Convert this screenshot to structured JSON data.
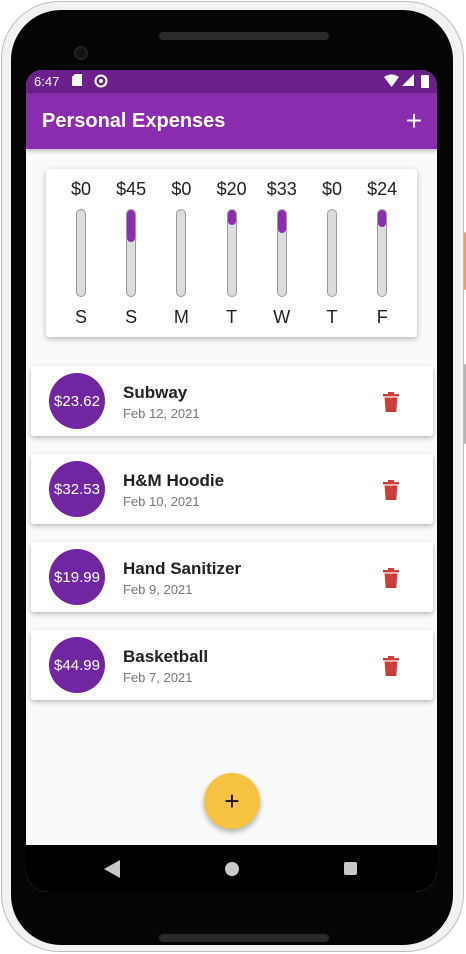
{
  "status_bar": {
    "time": "6:47",
    "icons": [
      "sd-card-icon",
      "sync-icon",
      "wifi-icon",
      "signal-icon",
      "battery-icon"
    ]
  },
  "app_bar": {
    "title": "Personal Expenses",
    "add_icon": "+"
  },
  "chart": {
    "accent_color": "#8e2cae",
    "days": [
      {
        "day": "S",
        "amount": "$0",
        "fraction": 0.0
      },
      {
        "day": "S",
        "amount": "$45",
        "fraction": 0.37
      },
      {
        "day": "M",
        "amount": "$0",
        "fraction": 0.0
      },
      {
        "day": "T",
        "amount": "$20",
        "fraction": 0.17
      },
      {
        "day": "W",
        "amount": "$33",
        "fraction": 0.27
      },
      {
        "day": "T",
        "amount": "$0",
        "fraction": 0.0
      },
      {
        "day": "F",
        "amount": "$24",
        "fraction": 0.2
      }
    ]
  },
  "transactions": [
    {
      "amount": "$23.62",
      "title": "Subway",
      "date": "Feb 12, 2021"
    },
    {
      "amount": "$32.53",
      "title": "H&M Hoodie",
      "date": "Feb 10, 2021"
    },
    {
      "amount": "$19.99",
      "title": "Hand Sanitizer",
      "date": "Feb 9, 2021"
    },
    {
      "amount": "$44.99",
      "title": "Basketball",
      "date": "Feb 7, 2021"
    }
  ],
  "fab": {
    "label": "+"
  },
  "colors": {
    "app_bar": "#8a2cae",
    "status_bar": "#6a1f8a",
    "avatar": "#7026a0",
    "delete": "#c9403a",
    "fab": "#f5c242"
  }
}
